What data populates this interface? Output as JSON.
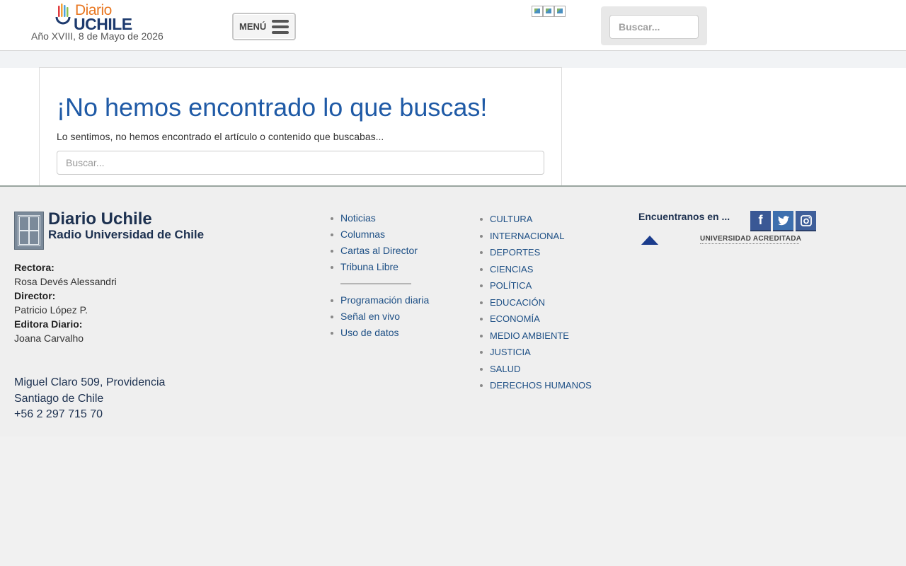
{
  "header": {
    "logo_top": "Diario",
    "logo_bottom": "UCHILE",
    "date_line": "Año XVIII, 8 de Mayo de 2026",
    "menu_label": "MENÚ",
    "search_placeholder": "Buscar..."
  },
  "main": {
    "title": "¡No hemos encontrado lo que buscas!",
    "message": "Lo sentimos, no hemos encontrado el artículo o contenido que buscabas...",
    "search_placeholder": "Buscar..."
  },
  "footer": {
    "brand_title": "Diario Uchile",
    "brand_subtitle": "Radio Universidad de Chile",
    "staff": [
      {
        "role": "Rectora:",
        "name": "Rosa Devés Alessandri"
      },
      {
        "role": "Director:",
        "name": "Patricio López P."
      },
      {
        "role": "Editora Diario:",
        "name": "Joana Carvalho"
      }
    ],
    "address": [
      "Miguel Claro 509, Providencia",
      "Santiago de Chile",
      "+56 2 297 715 70"
    ],
    "links_primary": [
      "Noticias",
      "Columnas",
      "Cartas al Director",
      "Tribuna Libre"
    ],
    "links_secondary": [
      "Programación diaria",
      "Señal en vivo",
      "Uso de datos"
    ],
    "sections": [
      "CULTURA",
      "INTERNACIONAL",
      "DEPORTES",
      "CIENCIAS",
      "POLÍTICA",
      "EDUCACIÓN",
      "ECONOMÍA",
      "MEDIO AMBIENTE",
      "JUSTICIA",
      "SALUD",
      "DERECHOS HUMANOS"
    ],
    "social_label": "Encuentranos en ...",
    "social_icons": [
      "facebook-icon",
      "twitter-icon",
      "instagram-icon"
    ],
    "accreditation_text": "UNIVERSIDAD ACREDITADA"
  },
  "colors": {
    "title_blue": "#1f5aa6",
    "link_blue": "#1d4f85",
    "brand_navy": "#1d3150",
    "logo_orange": "#e87722"
  }
}
